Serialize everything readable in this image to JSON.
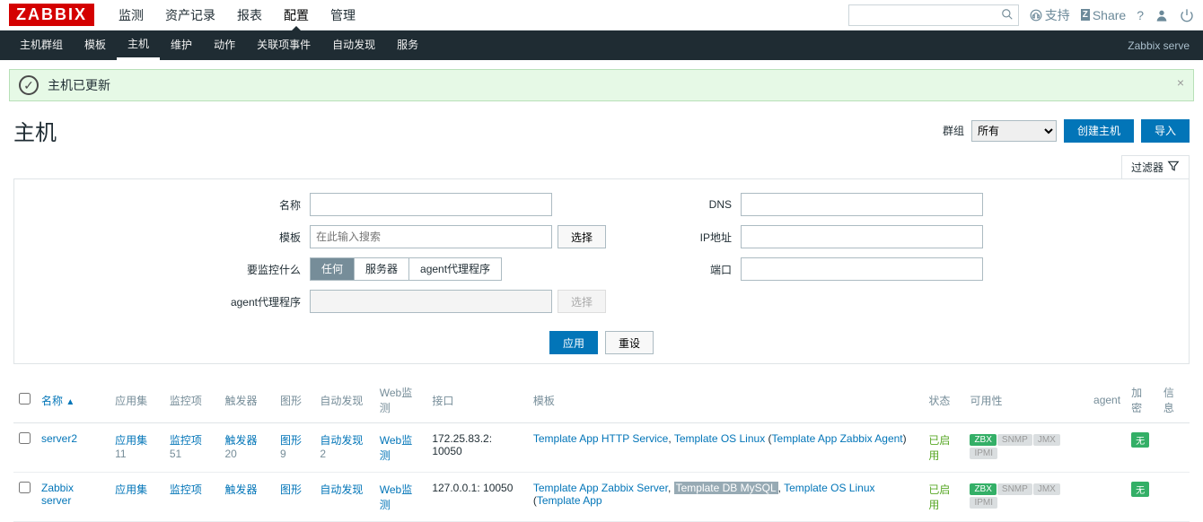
{
  "logo": "ZABBIX",
  "top_nav": [
    "监测",
    "资产记录",
    "报表",
    "配置",
    "管理"
  ],
  "top_nav_active": 3,
  "sub_nav": [
    "主机群组",
    "模板",
    "主机",
    "维护",
    "动作",
    "关联项事件",
    "自动发现",
    "服务"
  ],
  "sub_nav_active": 2,
  "server_label": "Zabbix serve",
  "header": {
    "support": "支持",
    "share": "Share"
  },
  "msg": {
    "text": "主机已更新"
  },
  "title": "主机",
  "title_controls": {
    "group_label": "群组",
    "group_value": "所有",
    "create": "创建主机",
    "import": "导入"
  },
  "filter_tab": "过滤器",
  "filter": {
    "name_label": "名称",
    "tpl_label": "模板",
    "tpl_placeholder": "在此输入搜索",
    "tpl_select": "选择",
    "monitor_label": "要监控什么",
    "monitor_opts": [
      "任何",
      "服务器",
      "agent代理程序"
    ],
    "monitor_active": 0,
    "agent_label": "agent代理程序",
    "agent_select": "选择",
    "dns_label": "DNS",
    "ip_label": "IP地址",
    "port_label": "端口",
    "apply": "应用",
    "reset": "重设"
  },
  "table": {
    "cols": {
      "name": "名称",
      "apps": "应用集",
      "items": "监控项",
      "triggers": "触发器",
      "graphs": "图形",
      "discovery": "自动发现",
      "web": "Web监测",
      "interface": "接口",
      "templates": "模板",
      "status": "状态",
      "availability": "可用性",
      "agent": "agent",
      "encryption": "加密",
      "info": "信息"
    },
    "rows": [
      {
        "name": "server2",
        "apps": {
          "label": "应用集",
          "count": "11"
        },
        "items": {
          "label": "监控项",
          "count": "51"
        },
        "triggers": {
          "label": "触发器",
          "count": "20"
        },
        "graphs": {
          "label": "图形",
          "count": "9"
        },
        "discovery": {
          "label": "自动发现",
          "count": "2"
        },
        "web": "Web监测",
        "interface": "172.25.83.2: 10050",
        "templates_html": "Template App HTTP Service, Template OS Linux (Template App Zabbix Agent)",
        "status": "已启用",
        "avail": [
          "ZBX",
          "SNMP",
          "JMX",
          "IPMI"
        ],
        "avail_active": 0,
        "enc": "无"
      },
      {
        "name": "Zabbix server",
        "apps": {
          "label": "应用集",
          "count": ""
        },
        "items": {
          "label": "监控项",
          "count": ""
        },
        "triggers": {
          "label": "触发器",
          "count": ""
        },
        "graphs": {
          "label": "图形",
          "count": ""
        },
        "discovery": {
          "label": "自动发现",
          "count": ""
        },
        "web": "Web监测",
        "interface": "127.0.0.1: 10050",
        "templates_html": "Template App Zabbix Server, Template DB MySQL, Template OS Linux (Template App",
        "status": "已启用",
        "avail": [
          "ZBX",
          "SNMP",
          "JMX",
          "IPMI"
        ],
        "avail_active": 0,
        "enc": "无"
      }
    ]
  }
}
